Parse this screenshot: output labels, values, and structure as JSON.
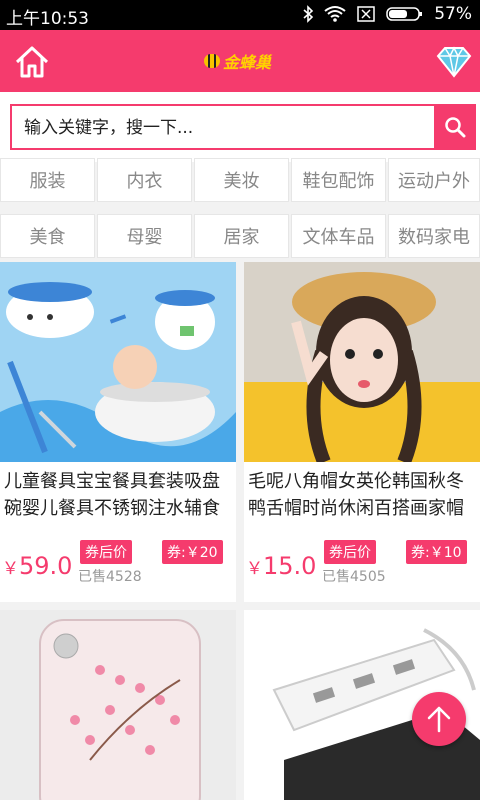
{
  "status_bar": {
    "time": "上午10:53",
    "battery": "57%"
  },
  "header": {
    "logo_text": "金蜂巢",
    "home_icon": "home-icon",
    "gem_icon": "diamond-icon"
  },
  "search": {
    "placeholder": "输入关键字，搜一下..."
  },
  "categories_row1": [
    "服装",
    "内衣",
    "美妆",
    "鞋包配饰",
    "运动户外"
  ],
  "categories_row2": [
    "美食",
    "母婴",
    "居家",
    "文体车品",
    "数码家电"
  ],
  "products": [
    {
      "title": "儿童餐具宝宝餐具套装吸盘碗婴儿餐具不锈钢注水辅食",
      "currency": "￥",
      "price": "59.0",
      "sold": "已售4528",
      "after_label": "券后价",
      "coupon": "券:￥20"
    },
    {
      "title": "毛呢八角帽女英伦韩国秋冬鸭舌帽时尚休闲百搭画家帽",
      "currency": "￥",
      "price": "15.0",
      "sold": "已售4505",
      "after_label": "券后价",
      "coupon": "券:￥10"
    }
  ],
  "colors": {
    "accent": "#f53b6d"
  }
}
